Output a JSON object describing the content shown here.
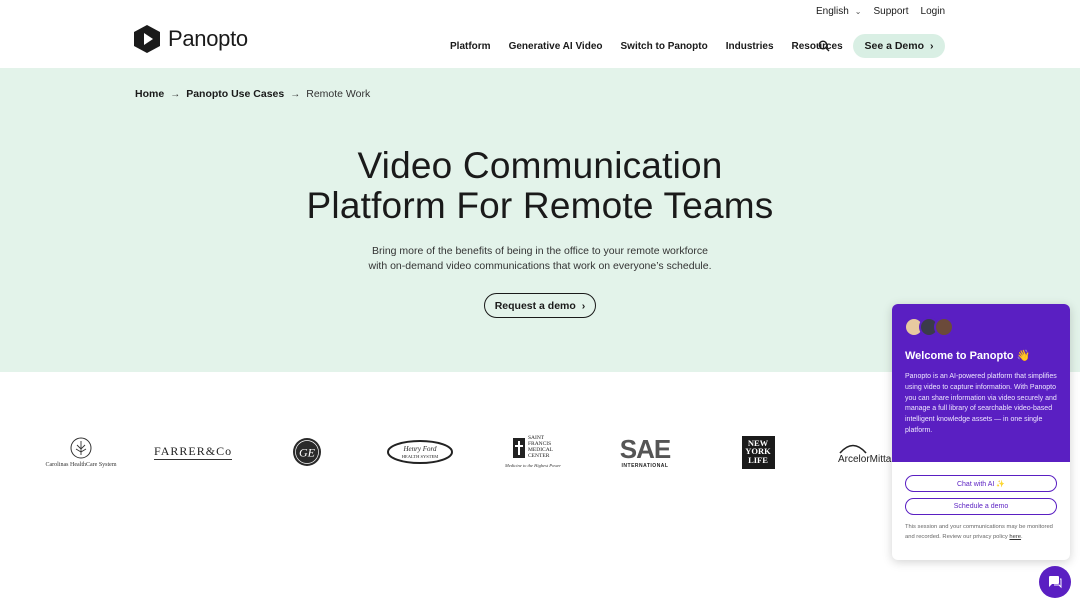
{
  "header": {
    "logo_text": "Panopto",
    "language": "English",
    "support": "Support",
    "login": "Login",
    "nav": [
      "Platform",
      "Generative AI Video",
      "Switch to Panopto",
      "Industries",
      "Resources"
    ],
    "demo_label": "See a Demo"
  },
  "breadcrumb": {
    "home": "Home",
    "parent": "Panopto Use Cases",
    "current": "Remote Work"
  },
  "hero": {
    "title_line1": "Video Communication",
    "title_line2": "Platform For Remote Teams",
    "sub_line1": "Bring more of the benefits of being in the office to your remote workforce",
    "sub_line2": "with on-demand video communications that work on everyone’s schedule.",
    "cta": "Request a demo"
  },
  "logos": {
    "carolinas": "Carolinas HealthCare System",
    "farrer": "FARRER&Co",
    "ge": "GE",
    "henry_ford": "Henry Ford Health System",
    "saint_francis_l1": "SAINT",
    "saint_francis_l2": "FRANCIS",
    "saint_francis_l3": "MEDICAL",
    "saint_francis_l4": "CENTER",
    "saint_francis_tag": "Medicine to the Highest Power",
    "sae": "SAE",
    "sae_sub": "INTERNATIONAL",
    "nyl_l1": "NEW",
    "nyl_l2": "YORK",
    "nyl_l3": "LIFE",
    "arcelor": "ArcelorMitta"
  },
  "chat": {
    "title": "Welcome to Panopto 👋",
    "body": "Panopto is an AI-powered platform that simplifies using video to capture information. With Panopto you can share information via video securely and manage a full library of searchable video-based intelligent knowledge assets — in one single platform.",
    "chat_ai": "Chat with AI ✨",
    "schedule": "Schedule a demo",
    "legal": "This session and your communications may be monitored and recorded. Review our privacy policy",
    "legal_link": "here",
    "accent": "#5a1fc2"
  }
}
